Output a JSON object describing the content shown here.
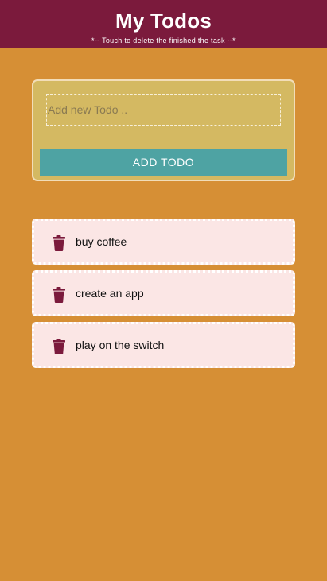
{
  "header": {
    "title": "My Todos",
    "subtitle": "*-- Touch to delete the finished the task --*"
  },
  "form": {
    "input_placeholder": "Add new Todo ..",
    "input_value": "",
    "add_button_label": "ADD TODO"
  },
  "todos": [
    {
      "text": "buy coffee",
      "icon": "trash-icon"
    },
    {
      "text": "create an app",
      "icon": "trash-icon"
    },
    {
      "text": "play on the switch",
      "icon": "trash-icon"
    }
  ],
  "colors": {
    "background": "#d68f35",
    "header": "#7b1a3c",
    "form_card": "#d4b962",
    "button": "#4ea3a3",
    "todo_item": "#fbe6e5",
    "icon": "#7b1a3c"
  }
}
